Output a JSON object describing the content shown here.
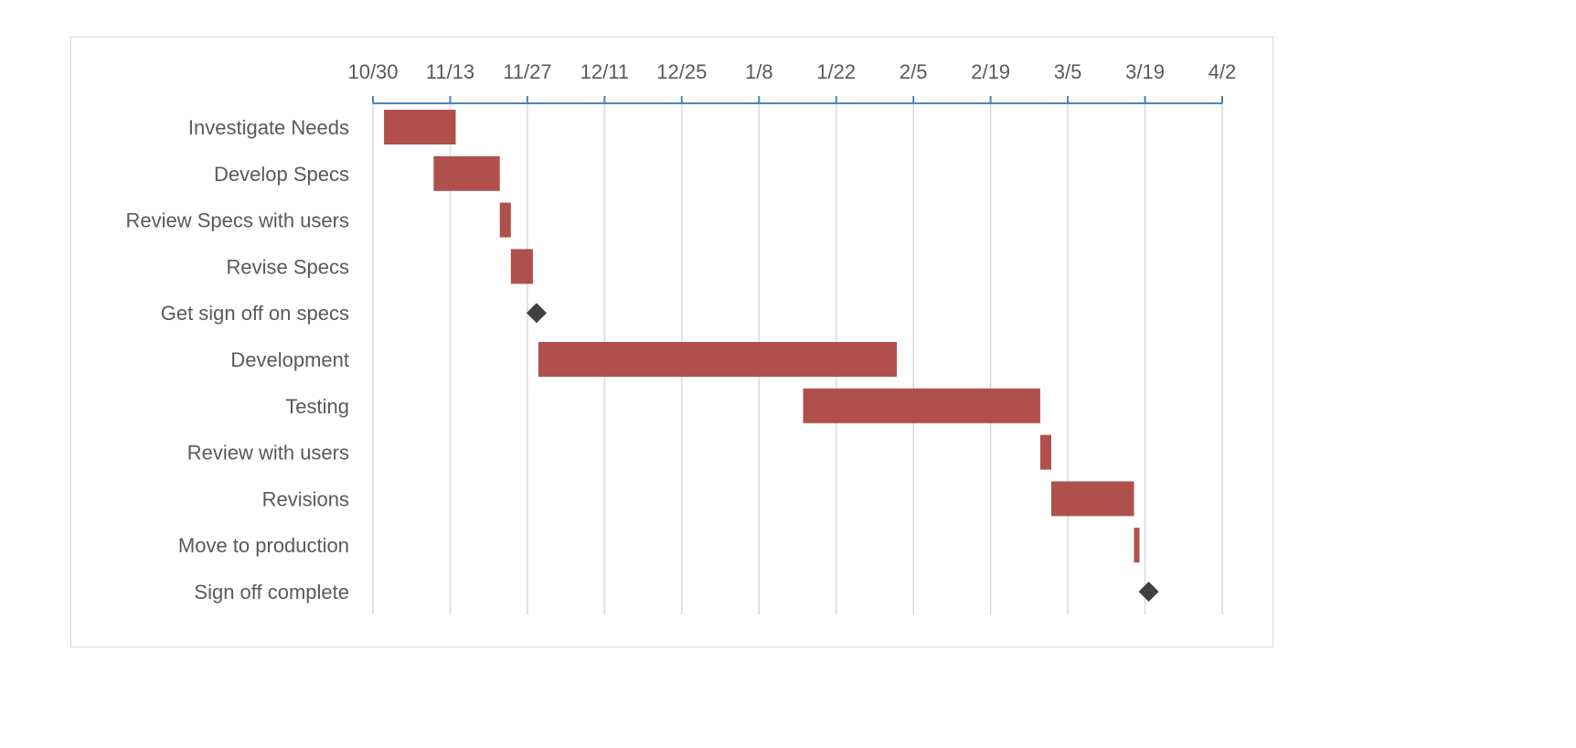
{
  "chart_data": {
    "type": "gantt",
    "title": "",
    "xlabel": "",
    "ylabel": "",
    "axis_position": "top",
    "grid": true,
    "x_ticks": [
      "10/30",
      "11/13",
      "11/27",
      "12/11",
      "12/25",
      "1/8",
      "1/22",
      "2/5",
      "2/19",
      "3/5",
      "3/19",
      "4/2"
    ],
    "x_tick_interval_days": 14,
    "x_range_days": [
      0,
      154
    ],
    "x_origin_label": "10/30",
    "bar_color": "#b0504c",
    "milestone_color": "#404040",
    "axis_color": "#4f81bd",
    "grid_color": "#d9d9d9",
    "tasks": [
      {
        "name": "Investigate Needs",
        "type": "task",
        "start_day": 2,
        "duration_days": 13,
        "start": "11/1",
        "end": "11/14"
      },
      {
        "name": "Develop Specs",
        "type": "task",
        "start_day": 11,
        "duration_days": 12,
        "start": "11/10",
        "end": "11/22"
      },
      {
        "name": "Review Specs with users",
        "type": "task",
        "start_day": 23,
        "duration_days": 2,
        "start": "11/22",
        "end": "11/24"
      },
      {
        "name": "Revise Specs",
        "type": "task",
        "start_day": 25,
        "duration_days": 4,
        "start": "11/24",
        "end": "11/28"
      },
      {
        "name": "Get sign off on specs",
        "type": "milestone",
        "start_day": 30,
        "duration_days": 0,
        "start": "11/29",
        "end": "11/29"
      },
      {
        "name": "Development",
        "type": "task",
        "start_day": 30,
        "duration_days": 65,
        "start": "11/29",
        "end": "2/2"
      },
      {
        "name": "Testing",
        "type": "task",
        "start_day": 78,
        "duration_days": 43,
        "start": "1/16",
        "end": "2/28"
      },
      {
        "name": "Review with users",
        "type": "task",
        "start_day": 121,
        "duration_days": 2,
        "start": "2/28",
        "end": "3/1"
      },
      {
        "name": "Revisions",
        "type": "task",
        "start_day": 123,
        "duration_days": 15,
        "start": "3/2",
        "end": "3/17"
      },
      {
        "name": "Move to production",
        "type": "task",
        "start_day": 138,
        "duration_days": 1,
        "start": "3/17",
        "end": "3/18"
      },
      {
        "name": "Sign off complete",
        "type": "milestone",
        "start_day": 141,
        "duration_days": 0,
        "start": "3/20",
        "end": "3/20"
      }
    ]
  }
}
